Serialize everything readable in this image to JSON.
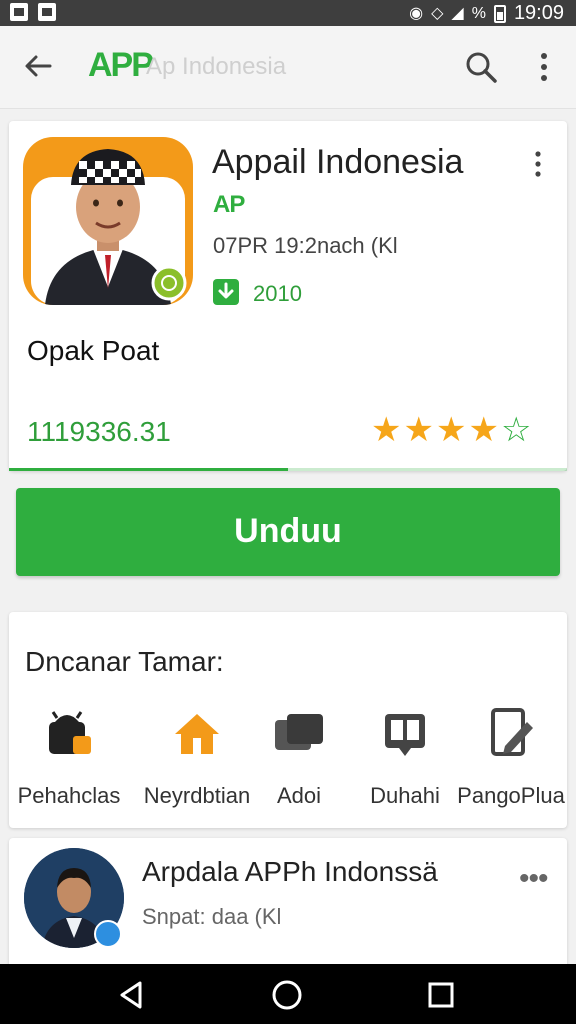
{
  "status_bar": {
    "time": "19:09",
    "icons": [
      "image-icon",
      "image-icon",
      "wifi-icon",
      "vibrate-icon",
      "signal-icon",
      "battery-icon"
    ],
    "battery_symbol": "%"
  },
  "app_bar": {
    "logo_text": "APP",
    "title": "Ap Indonesia",
    "icons": [
      "back-arrow-icon",
      "search-icon",
      "more-vert-icon"
    ]
  },
  "app": {
    "title": "Appail Indonesia",
    "developer": "AP",
    "meta": "07PR 19:2nach  (Kl",
    "downloads": "2010",
    "subtitle": "Opak Poat",
    "rating_value": "1119336.31",
    "rating_stars": 4,
    "rating_max": 5,
    "download_progress": 0.5
  },
  "install_button": {
    "label": "Unduu"
  },
  "categories": {
    "title": "Dncanar Tamar:",
    "items": [
      {
        "label": "Pehahclas",
        "icon": "android-bag-icon"
      },
      {
        "label": "Neyrdbtian",
        "icon": "home-icon"
      },
      {
        "label": "Adoi",
        "icon": "cards-icon"
      },
      {
        "label": "Duhahi",
        "icon": "book-icon"
      },
      {
        "label": "PangoPlua",
        "icon": "document-edit-icon"
      }
    ]
  },
  "developer_card": {
    "name": "Arpdala APPh Indonssä",
    "subtitle": "Snpat: daa  (Kl"
  },
  "colors": {
    "accent_green": "#2fae3f",
    "star_orange": "#f6a61a",
    "icon_orange": "#f39a19",
    "status_bar": "#3e3e3e"
  }
}
